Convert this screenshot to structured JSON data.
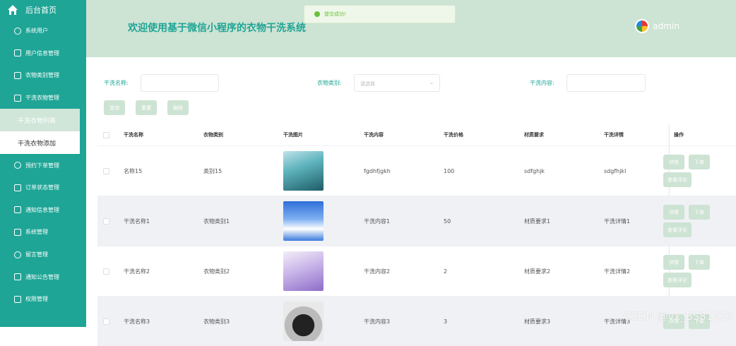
{
  "sidebar": {
    "home": "后台首页",
    "items": [
      {
        "label": "系统用户",
        "icon": "chat-icon"
      },
      {
        "label": "用户信息管理",
        "icon": "edit-icon"
      },
      {
        "label": "衣物类别管理",
        "icon": "box-icon"
      },
      {
        "label": "干洗衣物管理",
        "icon": "edit-icon"
      }
    ],
    "submenu": [
      {
        "label": "干洗衣物列表",
        "active": true
      },
      {
        "label": "干洗衣物添加",
        "active": false
      }
    ],
    "items2": [
      {
        "label": "预约下单管理",
        "icon": "chat-icon"
      },
      {
        "label": "订单状态管理",
        "icon": "box-icon"
      },
      {
        "label": "通知信息管理",
        "icon": "box-icon"
      },
      {
        "label": "系统管理",
        "icon": "edit-icon"
      },
      {
        "label": "留言管理",
        "icon": "chat-icon"
      },
      {
        "label": "通知公告管理",
        "icon": "edit-icon"
      },
      {
        "label": "权限管理",
        "icon": "box-icon"
      }
    ]
  },
  "header": {
    "title": "欢迎使用基于微信小程序的衣物干洗系统",
    "user": "admin"
  },
  "toast": "提交成功!",
  "filters": {
    "name_label": "干洗名称:",
    "category_label": "衣物类别:",
    "category_placeholder": "请选择",
    "content_label": "干洗内容:"
  },
  "buttons": {
    "query": "查询",
    "reset": "重置",
    "delete": "删除"
  },
  "table": {
    "headers": [
      "干洗名称",
      "衣物类别",
      "干洗图片",
      "干洗内容",
      "干洗价格",
      "材质要求",
      "干洗详情",
      "操作"
    ],
    "rows": [
      {
        "name": "名称15",
        "category": "类别15",
        "content": "fgdhfjgkh",
        "price": "100",
        "material": "sdfghjk",
        "detail": "sdgfhjkl"
      },
      {
        "name": "干洗名称1",
        "category": "衣物类别1",
        "content": "干洗内容1",
        "price": "50",
        "material": "材质要求1",
        "detail": "干洗详情1"
      },
      {
        "name": "干洗名称2",
        "category": "衣物类别2",
        "content": "干洗内容2",
        "price": "2",
        "material": "材质要求2",
        "detail": "干洗详情2"
      },
      {
        "name": "干洗名称3",
        "category": "衣物类别3",
        "content": "干洗内容3",
        "price": "3",
        "material": "材质要求3",
        "detail": "干洗详情3"
      }
    ],
    "op_labels": {
      "detail": "详情",
      "order": "下单",
      "review": "查看评论"
    }
  },
  "watermark": "CSDN @vx_BS81330",
  "colors": {
    "sidebar": "#1ea596",
    "header": "#cde3d3",
    "button": "#cde3d3",
    "success": "#67c23a"
  }
}
